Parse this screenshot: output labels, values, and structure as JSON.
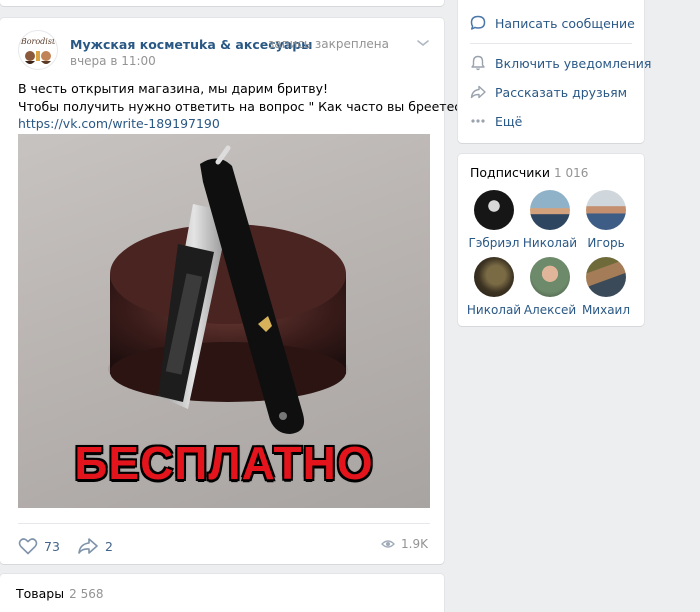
{
  "post": {
    "author": "Мужская косметuka & аксесуары",
    "pinned_label": "запись закреплена",
    "time": "вчера в 11:00",
    "text_line1": "В честь открытия магазина, мы дарим бритву!",
    "text_line2": "Чтобы получить нужно ответить на вопрос \" Как часто вы бреетесь? \" сюда",
    "link": "https://vk.com/write-189197190",
    "image_caption": "БЕСПЛАТНО",
    "logo_text": "Borodist",
    "likes": "73",
    "shares": "2",
    "views": "1.9K"
  },
  "goods": {
    "title": "Товары",
    "count": "2 568"
  },
  "side_menu": {
    "write_message": "Написать сообщение",
    "notifications": "Включить уведомления",
    "tell_friends": "Рассказать друзьям",
    "more": "Ещё"
  },
  "subscribers": {
    "title": "Подписчики",
    "count": "1 016",
    "people": [
      {
        "name": "Гэбриэл"
      },
      {
        "name": "Николай"
      },
      {
        "name": "Игорь"
      },
      {
        "name": "Николай"
      },
      {
        "name": "Алексей"
      },
      {
        "name": "Михаил"
      }
    ]
  },
  "colors": {
    "link": "#2a5885",
    "muted": "#939393",
    "background": "#edeef0",
    "promo_red": "#e3141c"
  }
}
